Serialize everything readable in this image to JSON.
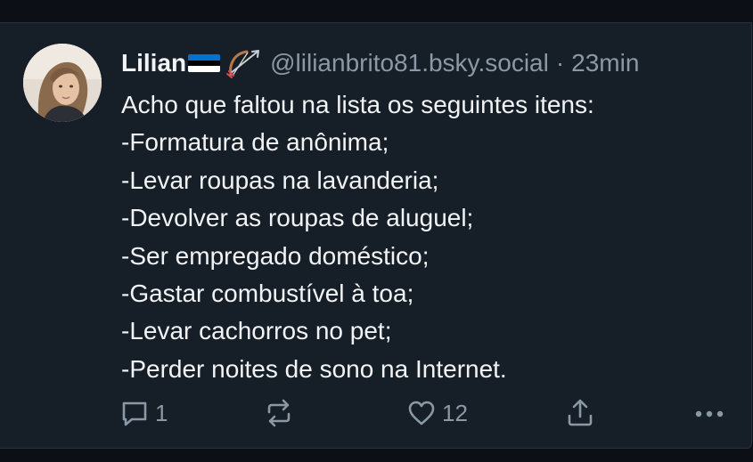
{
  "post": {
    "author": {
      "display_name": "Lilian",
      "flag_colors": [
        "#0072ce",
        "#000000",
        "#ffffff"
      ],
      "emoji_icon": "bow-and-arrow-icon",
      "handle": "@lilianbrito81.bsky.social"
    },
    "separator": "·",
    "timestamp": "23min",
    "text_lines": [
      "Acho que faltou na lista os seguintes itens:",
      "-Formatura de anônima;",
      "-Levar roupas na lavanderia;",
      "-Devolver as roupas de aluguel;",
      "-Ser empregado doméstico;",
      "-Gastar combustível à toa;",
      "-Levar cachorros no pet;",
      "-Perder noites de sono na Internet."
    ],
    "actions": {
      "reply": {
        "icon": "reply-icon",
        "count": "1"
      },
      "repost": {
        "icon": "repost-icon"
      },
      "like": {
        "icon": "heart-icon",
        "count": "12"
      },
      "share": {
        "icon": "share-icon"
      },
      "more": {
        "icon": "more-icon"
      }
    }
  },
  "colors": {
    "background": "#0c1016",
    "card": "#161e27",
    "text": "#f1f3f5",
    "muted": "#8b98a5"
  }
}
